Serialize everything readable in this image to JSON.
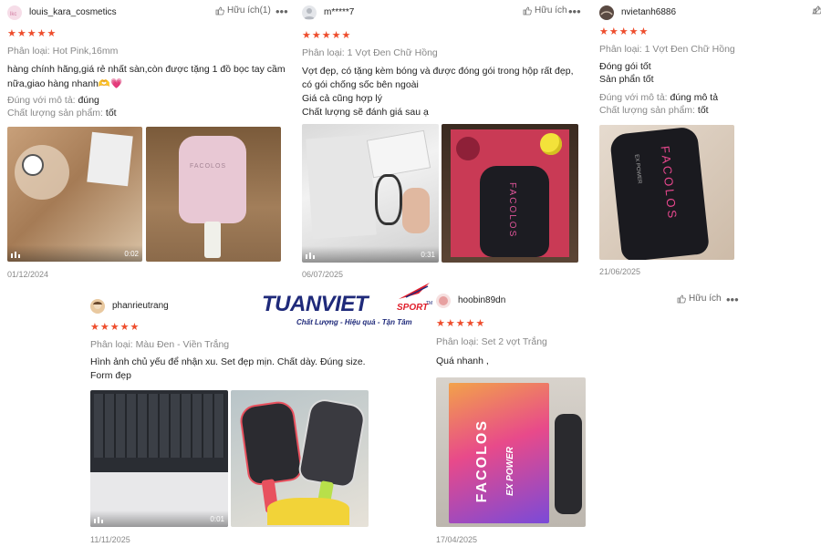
{
  "reviews": [
    {
      "username": "louis_kara_cosmetics",
      "helpful": "Hữu ích(1)",
      "rating": "★★★★★",
      "variant": "Phân loại: Hot Pink,16mm",
      "text_lines": [
        "hàng chính hãng,giá rẻ nhất sàn,còn được tặng 1 đồ bọc tay cầm",
        "nữa,giao hàng nhanh🫶💗"
      ],
      "meta1_label": "Đúng với mô tả:",
      "meta1_value": "đúng",
      "meta2_label": "Chất lượng sản phẩm:",
      "meta2_value": "tốt",
      "video_time": "0:02",
      "date": "01/12/2024"
    },
    {
      "username": "m*****7",
      "helpful": "Hữu ích",
      "rating": "★★★★★",
      "variant": "Phân loại: 1 Vợt Đen Chữ Hồng",
      "text_lines": [
        "Vợt đẹp, có tặng kèm bóng và được đóng gói trong hộp rất đẹp,",
        "có gói chống sốc bên ngoài",
        "Giá cả cũng hợp lý",
        "Chất lượng sẽ đánh giá sau ạ"
      ],
      "video_time": "0:31",
      "date": "06/07/2025"
    },
    {
      "username": "nvietanh6886",
      "rating": "★★★★★",
      "variant": "Phân loại: 1 Vợt Đen Chữ Hồng",
      "text_lines": [
        "Đóng gói tốt",
        "Sản phẩn tốt"
      ],
      "meta1_label": "Đúng với mô tả:",
      "meta1_value": "đúng mô tả",
      "meta2_label": "Chất lượng sản phẩm:",
      "meta2_value": "tốt",
      "date": "21/06/2025"
    },
    {
      "username": "phanrieutrang",
      "rating": "★★★★★",
      "variant": "Phân loại: Màu Đen - Viền Trắng",
      "text_lines": [
        "Hình ảnh chủ yếu để nhận xu. Set đẹp mịn. Chất dày. Đúng size.",
        "Form đẹp"
      ],
      "video_time": "0:01",
      "date": "11/11/2025"
    },
    {
      "username": "hoobin89dn",
      "helpful": "Hữu ích",
      "rating": "★★★★★",
      "variant": "Phân loại: Set 2 vợt Trắng",
      "text_lines": [
        "Quá nhanh ,"
      ],
      "date": "17/04/2025"
    }
  ],
  "logo": {
    "brand": "TUANVIET",
    "sport": "SPORT",
    "tm": "TM",
    "tagline": "Chất Lượng - Hiệu quả - Tận Tâm"
  },
  "product_text": {
    "paddle_brand": "FACOLOS",
    "series": "EX POWER"
  },
  "colors": {
    "star": "#ee4d2d",
    "logo_blue": "#1f2a7a",
    "logo_red": "#e01e2b"
  },
  "icons": [
    "thumb-up-icon",
    "more-icon",
    "video-icon"
  ]
}
